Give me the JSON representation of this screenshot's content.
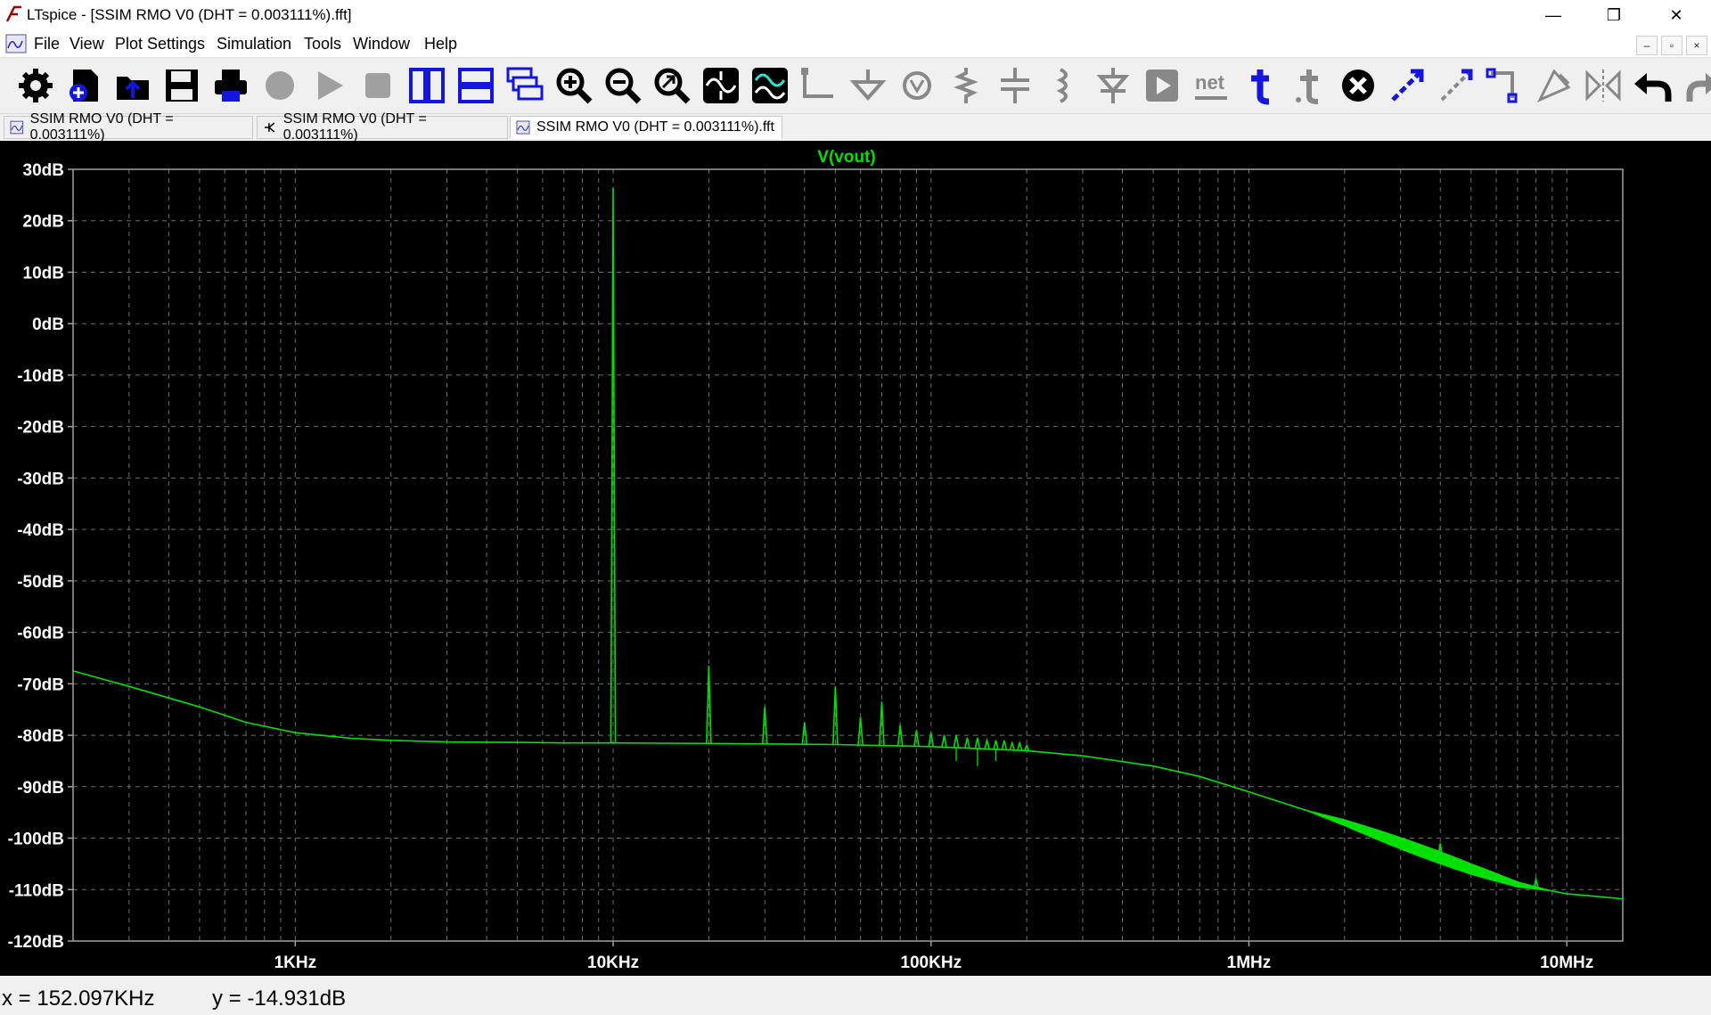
{
  "window": {
    "title": "LTspice - [SSIM RMO V0 (DHT = 0.003111%).fft]",
    "buttons": [
      "—",
      "❐",
      "✕"
    ]
  },
  "menu": {
    "items": [
      "File",
      "View",
      "Plot Settings",
      "Simulation",
      "Tools",
      "Window",
      "Help"
    ],
    "mdi_buttons": [
      "–",
      "▫",
      "×"
    ]
  },
  "toolbar": {
    "icons": [
      "gear-icon",
      "new-schematic-icon",
      "open-icon",
      "save-icon",
      "print-icon",
      "halt-icon",
      "run-icon",
      "stop-icon",
      "tile-vertical-icon",
      "tile-horizontal-icon",
      "cascade-icon",
      "zoom-in-icon",
      "zoom-out-icon",
      "zoom-fit-icon",
      "autorange-icon",
      "add-trace-icon",
      "wire-icon",
      "ground-icon",
      "voltage-source-icon",
      "resistor-icon",
      "capacitor-icon",
      "inductor-icon",
      "diode-icon",
      "component-icon",
      "net-label-icon",
      "text-icon",
      "spice-directive-icon",
      "delete-icon",
      "move-icon",
      "drag-icon",
      "rotate-icon",
      "mirror-icon",
      "flip-icon",
      "undo-icon",
      "redo-icon"
    ]
  },
  "tabs": [
    {
      "label": "SSIM RMO V0 (DHT = 0.003111%)",
      "icon": "waveform-doc-icon",
      "active": false
    },
    {
      "label": "SSIM RMO V0 (DHT = 0.003111%)",
      "icon": "schematic-doc-icon",
      "active": false
    },
    {
      "label": "SSIM RMO V0 (DHT = 0.003111%).fft",
      "icon": "waveform-doc-icon",
      "active": true
    }
  ],
  "status": {
    "x_readout": "x = 152.097KHz",
    "y_readout": "y = -14.931dB"
  },
  "colors": {
    "trace": "#00e000",
    "grid": "#6e6e6e",
    "plot_background": "#000000",
    "toolbar_icon": "#1515e0"
  },
  "chart_data": {
    "type": "line",
    "title": "V(vout)",
    "xscale": "log",
    "xlim": [
      200,
      15000000
    ],
    "ylim": [
      -120,
      30
    ],
    "grid": true,
    "yticks": [
      30,
      20,
      10,
      0,
      -10,
      -20,
      -30,
      -40,
      -50,
      -60,
      -70,
      -80,
      -90,
      -100,
      -110,
      -120
    ],
    "ytick_labels": [
      "30dB",
      "20dB",
      "10dB",
      "0dB",
      "-10dB",
      "-20dB",
      "-30dB",
      "-40dB",
      "-50dB",
      "-60dB",
      "-70dB",
      "-80dB",
      "-90dB",
      "-100dB",
      "-110dB",
      "-120dB"
    ],
    "xticks": [
      1000,
      10000,
      100000,
      1000000,
      10000000
    ],
    "xtick_labels": [
      "1KHz",
      "10KHz",
      "100KHz",
      "1MHz",
      "10MHz"
    ],
    "series": [
      {
        "name": "V(vout)",
        "noise_floor": {
          "x": [
            200,
            300,
            500,
            700,
            1000,
            1500,
            2000,
            3000,
            5000,
            7000,
            10000,
            20000,
            50000,
            100000,
            200000,
            300000,
            500000,
            700000,
            1000000,
            2000000,
            3000000,
            5000000,
            7000000,
            10000000,
            15000000
          ],
          "y": [
            -67.5,
            -70.5,
            -74.5,
            -77.5,
            -79.5,
            -80.6,
            -81.0,
            -81.3,
            -81.4,
            -81.5,
            -81.5,
            -81.6,
            -81.8,
            -82.2,
            -83.0,
            -84.0,
            -86.0,
            -88.0,
            -91.0,
            -97.0,
            -101.0,
            -106.0,
            -109.0,
            -110.8,
            -111.8
          ]
        },
        "peaks": [
          {
            "x": 10000,
            "y": 26.5
          },
          {
            "x": 20000,
            "y": -66.5
          },
          {
            "x": 30000,
            "y": -74.5
          },
          {
            "x": 40000,
            "y": -77.5
          },
          {
            "x": 50000,
            "y": -70.5
          },
          {
            "x": 60000,
            "y": -76.5
          },
          {
            "x": 70000,
            "y": -73.5
          },
          {
            "x": 80000,
            "y": -78.0
          },
          {
            "x": 90000,
            "y": -79.0
          },
          {
            "x": 100000,
            "y": -79.5
          },
          {
            "x": 110000,
            "y": -80.0
          },
          {
            "x": 120000,
            "y": -80.0
          },
          {
            "x": 130000,
            "y": -80.5
          },
          {
            "x": 140000,
            "y": -80.5
          },
          {
            "x": 150000,
            "y": -81.0
          },
          {
            "x": 160000,
            "y": -81.0
          },
          {
            "x": 170000,
            "y": -81.0
          },
          {
            "x": 180000,
            "y": -81.5
          },
          {
            "x": 190000,
            "y": -81.5
          },
          {
            "x": 200000,
            "y": -82.0
          },
          {
            "x": 4000000,
            "y": -101.0
          },
          {
            "x": 8000000,
            "y": -108.0
          }
        ],
        "dips": [
          {
            "x": 120000,
            "y": -85.0
          },
          {
            "x": 140000,
            "y": -86.0
          },
          {
            "x": 160000,
            "y": -85.0
          }
        ]
      }
    ]
  }
}
